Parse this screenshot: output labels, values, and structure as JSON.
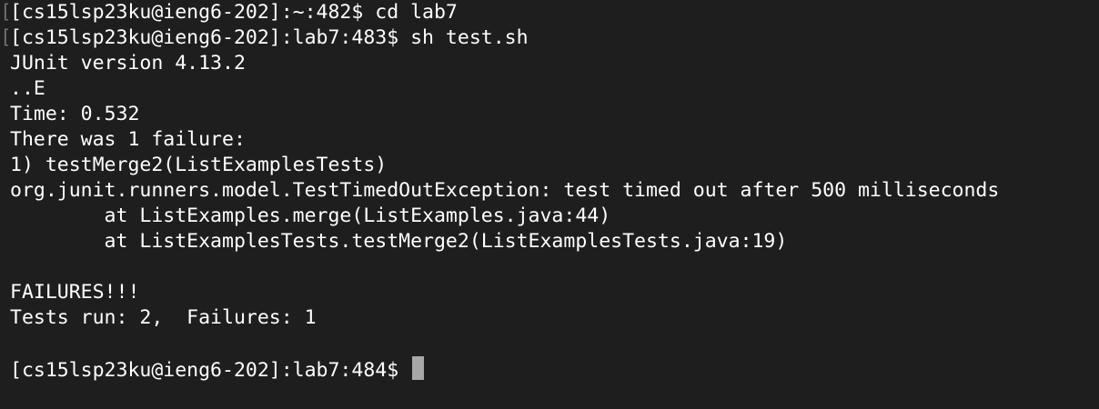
{
  "terminal": {
    "lines": [
      "[cs15lsp23ku@ieng6-202]:~:482$ cd lab7",
      "[cs15lsp23ku@ieng6-202]:lab7:483$ sh test.sh",
      "JUnit version 4.13.2",
      "..E",
      "Time: 0.532",
      "There was 1 failure:",
      "1) testMerge2(ListExamplesTests)",
      "org.junit.runners.model.TestTimedOutException: test timed out after 500 milliseconds",
      "        at ListExamples.merge(ListExamples.java:44)",
      "        at ListExamplesTests.testMerge2(ListExamplesTests.java:19)",
      "",
      "FAILURES!!!",
      "Tests run: 2,  Failures: 1",
      "",
      "[cs15lsp23ku@ieng6-202]:lab7:484$ "
    ],
    "mark_glyph": "["
  }
}
